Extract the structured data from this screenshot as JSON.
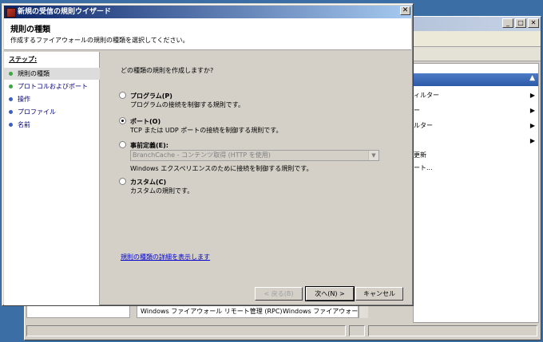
{
  "wizard": {
    "title": "新規の受信の規則ウイザード",
    "close_glyph": "✕",
    "header": {
      "title": "規則の種類",
      "subtitle": "作成するファイアウォールの規則の種類を選択してください。"
    },
    "steps": {
      "label": "ステップ:",
      "items": [
        {
          "label": "規則の種類",
          "active": true
        },
        {
          "label": "プロトコルおよびポート",
          "active": false
        },
        {
          "label": "操作",
          "active": false
        },
        {
          "label": "プロファイル",
          "active": false
        },
        {
          "label": "名前",
          "active": false
        }
      ],
      "dot_colors": {
        "active": "#3aa83a",
        "inactive": "#3aa83a"
      }
    },
    "question": "どの種類の規則を作成しますか?",
    "options": [
      {
        "title": "プログラム(P)",
        "desc": "プログラムの接続を制御する規則です。",
        "selected": false
      },
      {
        "title": "ポート(O)",
        "desc": "TCP または UDP ポートの接続を制御する規則です。",
        "selected": true
      },
      {
        "title": "事前定義(E):",
        "desc": "Windows エクスペリエンスのために接続を制御する規則です。",
        "selected": false
      },
      {
        "title": "カスタム(C)",
        "desc": "カスタムの規則です。",
        "selected": false
      }
    ],
    "predefined_combo_value": "BranchCache - コンテンツ取得 (HTTP を使用)",
    "details_link": "規則の種類の詳細を表示します",
    "buttons": {
      "back": "< 戻る(B)",
      "next": "次へ(N) >",
      "cancel": "キャンセル"
    }
  },
  "background_window": {
    "window_buttons": {
      "minimize": "_",
      "maximize": "□",
      "close": "✕"
    },
    "action_header_glyph": "▲",
    "actions": [
      {
        "label": "ィルター",
        "has_submenu": true
      },
      {
        "label": "ー",
        "has_submenu": true
      },
      {
        "label": "ルター",
        "has_submenu": true
      },
      {
        "label": "",
        "has_submenu": true
      },
      {
        "label": "更新",
        "has_submenu": false
      },
      {
        "label": "ート...",
        "has_submenu": false
      }
    ],
    "list_row": {
      "col1": "Windows ファイアウォール リモート管理 (RPC)",
      "col2": "Windows ファイアウォー"
    }
  },
  "colors": {
    "desktop": "#3a6ea5",
    "title_active": "#0a246a",
    "link": "#0000cc"
  }
}
